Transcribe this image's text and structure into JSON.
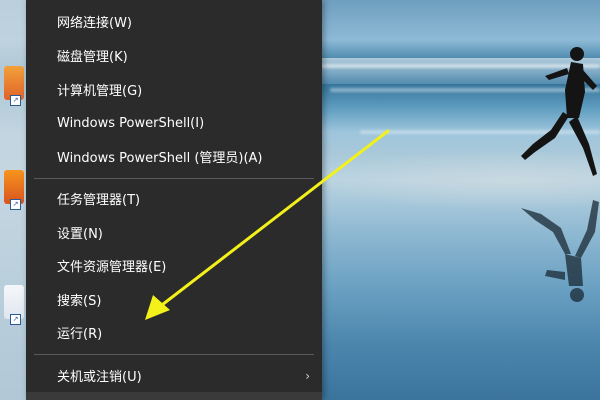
{
  "menu": {
    "items": [
      {
        "label": "网络连接(W)"
      },
      {
        "label": "磁盘管理(K)"
      },
      {
        "label": "计算机管理(G)"
      },
      {
        "label": "Windows PowerShell(I)"
      },
      {
        "label": "Windows PowerShell (管理员)(A)"
      },
      {
        "label": "任务管理器(T)"
      },
      {
        "label": "设置(N)"
      },
      {
        "label": "文件资源管理器(E)"
      },
      {
        "label": "搜索(S)"
      },
      {
        "label": "运行(R)"
      },
      {
        "label": "关机或注销(U)"
      }
    ],
    "submenu_icon": "chevron-right-icon"
  },
  "annotation": {
    "color": "#f4f11a",
    "icon": "yellow-arrow-pointing-to-run"
  },
  "colors": {
    "menu_background": "#2b2b2b",
    "menu_text": "#ffffff",
    "separator": "#5a5a5a"
  }
}
